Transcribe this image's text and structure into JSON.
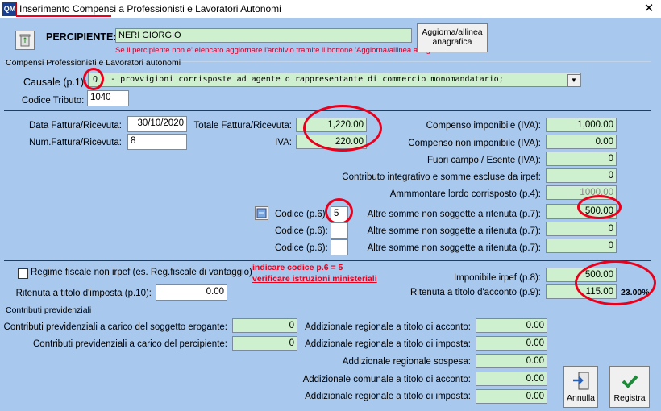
{
  "window": {
    "title": "Inserimento Compensi a Professionisti e Lavoratori Autonomi",
    "app_icon": "QM",
    "close_glyph": "✕"
  },
  "percipiente": {
    "label": "PERCIPIENTE:",
    "value": "NERI GIORGIO",
    "hint": "Se il percipiente non e' elencato aggiornare l'archivio tramite il bottone 'Aggiorna/allinea anagrafica'",
    "button_line1": "Aggiorna/allinea",
    "button_line2": "anagrafica"
  },
  "section_compensi": {
    "title": "Compensi Professionisti e Lavoratori autonomi",
    "causale_label": "Causale (p.1):",
    "causale_code": "Q",
    "causale_text": "- provvigioni corrisposte ad agente o rappresentante di commercio monomandatario;",
    "codice_tributo_label": "Codice Tributo:",
    "codice_tributo_value": "1040"
  },
  "fattura": {
    "data_label": "Data Fattura/Ricevuta:",
    "data_value": "30/10/2020",
    "num_label": "Num.Fattura/Ricevuta:",
    "num_value": "8",
    "totale_label": "Totale Fattura/Ricevuta:",
    "totale_value": "1,220.00",
    "iva_label": "IVA:",
    "iva_value": "220.00"
  },
  "right_fields": [
    {
      "label": "Compenso imponibile (IVA):",
      "value": "1,000.00"
    },
    {
      "label": "Compenso non imponibile (IVA):",
      "value": "0.00"
    },
    {
      "label": "Fuori campo / Esente (IVA):",
      "value": "0"
    },
    {
      "label": "Contributo integrativo e somme escluse da irpef:",
      "value": "0"
    },
    {
      "label": "Ammmontare lordo corrisposto (p.4):",
      "value": "1000.00"
    },
    {
      "label": "Altre somme non soggette a ritenuta (p.7):",
      "value": "500.00"
    },
    {
      "label": "Altre somme non soggette a ritenuta (p.7):",
      "value": "0"
    },
    {
      "label": "Altre somme non soggette a ritenuta (p.7):",
      "value": "0"
    }
  ],
  "codici": [
    {
      "label": "Codice (p.6):",
      "value": "5"
    },
    {
      "label": "Codice (p.6):",
      "value": ""
    },
    {
      "label": "Codice (p.6):",
      "value": ""
    }
  ],
  "regime": {
    "checkbox_label": "Regime fiscale non irpef (es. Reg.fiscale di vantaggio)",
    "note_line1": "indicare codice p.6 = 5",
    "note_line2": "verificare istruzioni ministeriali",
    "imponibile_label": "Imponibile irpef (p.8):",
    "imponibile_value": "500.00",
    "ritenuta_acconto_label": "Ritenuta a titolo d'acconto (p.9):",
    "ritenuta_acconto_value": "115.00",
    "aliquota": "23.00%",
    "ritenuta_imposta_label": "Ritenuta a titolo d'imposta (p.10):",
    "ritenuta_imposta_value": "0.00"
  },
  "section_contributi": {
    "title": "Contributi previdenziali",
    "left": [
      {
        "label": "Contributi previdenziali a carico del soggetto erogante:",
        "value": "0"
      },
      {
        "label": "Contributi previdenziali a carico del percipiente:",
        "value": "0"
      }
    ],
    "addizionali": [
      {
        "label": "Addizionale regionale a titolo di acconto:",
        "value": "0.00"
      },
      {
        "label": "Addizionale regionale a titolo di imposta:",
        "value": "0.00"
      },
      {
        "label": "Addizionale regionale sospesa:",
        "value": "0.00"
      },
      {
        "label": "Addizionale comunale a titolo di acconto:",
        "value": "0.00"
      },
      {
        "label": "Addizionale regionale a titolo di imposta:",
        "value": "0.00"
      }
    ]
  },
  "buttons": {
    "annulla": "Annulla",
    "registra": "Registra"
  },
  "colors": {
    "background": "#a8c8ee",
    "field_green": "#cff0cf",
    "annotation_red": "#e8001c"
  }
}
